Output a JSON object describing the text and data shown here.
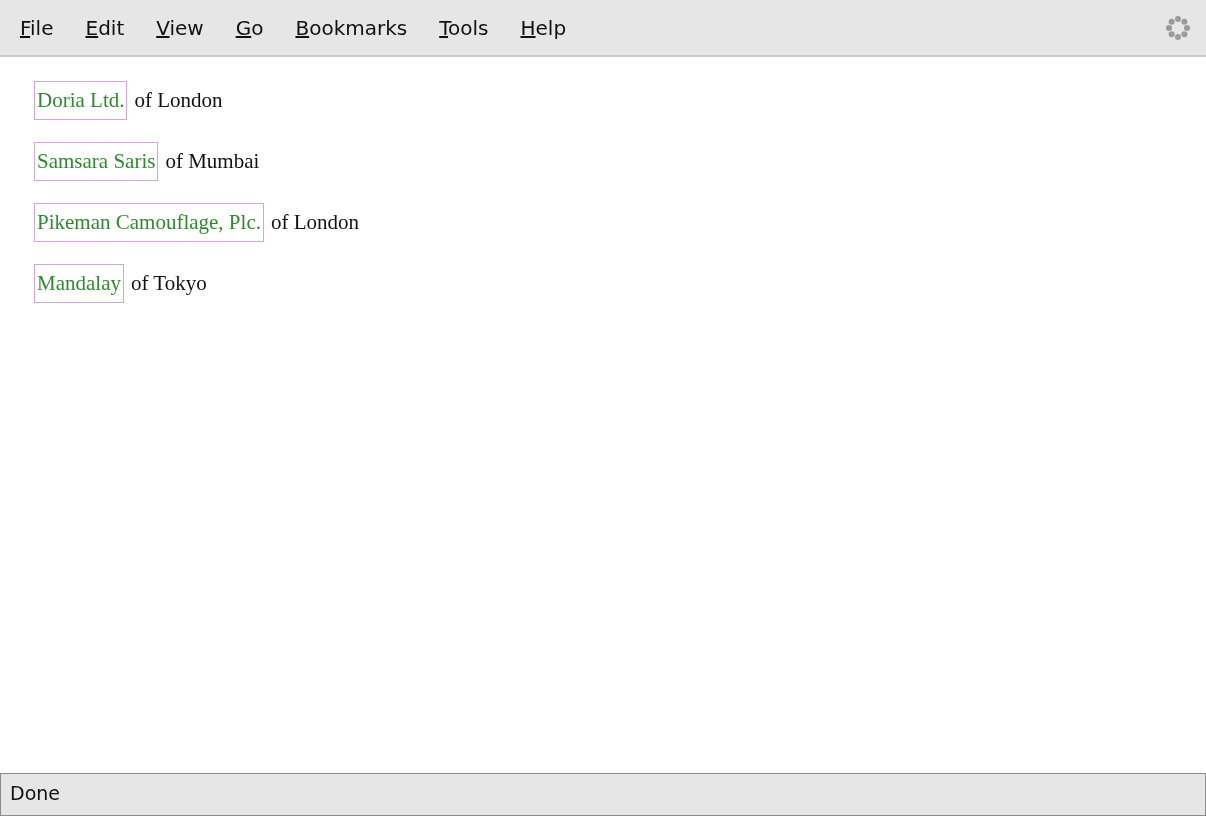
{
  "menu": [
    {
      "label": "File"
    },
    {
      "label": "Edit"
    },
    {
      "label": "View"
    },
    {
      "label": "Go"
    },
    {
      "label": "Bookmarks"
    },
    {
      "label": "Tools"
    },
    {
      "label": "Help"
    }
  ],
  "entries": [
    {
      "name": "Doria Ltd.",
      "location": "of London"
    },
    {
      "name": "Samsara Saris",
      "location": "of Mumbai"
    },
    {
      "name": "Pikeman Camouflage, Plc.",
      "location": "of London"
    },
    {
      "name": "Mandalay",
      "location": "of Tokyo"
    }
  ],
  "status_bar": {
    "text": "Done"
  }
}
